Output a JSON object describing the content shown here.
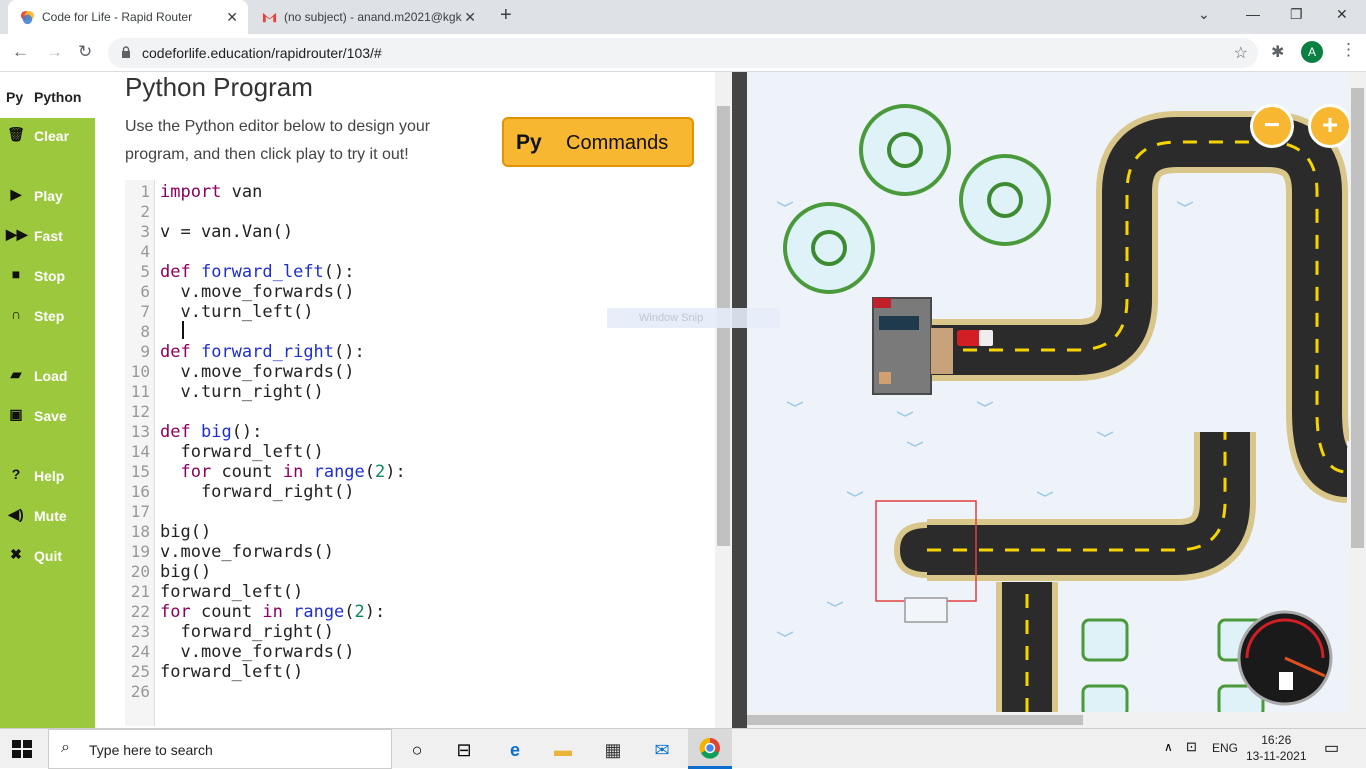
{
  "browser": {
    "tabs": [
      {
        "title": "Code for Life - Rapid Router"
      },
      {
        "title": "(no subject) - anand.m2021@kgk"
      }
    ],
    "url": "codeforlife.education/rapidrouter/103/#",
    "profile_initial": "A"
  },
  "sidebar": {
    "python_tab": {
      "badge": "Py",
      "label": "Python"
    },
    "buttons": [
      {
        "label": "Clear",
        "icon": "trash-icon"
      },
      {
        "label": "Play",
        "icon": "play-icon"
      },
      {
        "label": "Fast",
        "icon": "fast-forward-icon"
      },
      {
        "label": "Stop",
        "icon": "stop-icon"
      },
      {
        "label": "Step",
        "icon": "step-icon"
      },
      {
        "label": "Load",
        "icon": "folder-icon"
      },
      {
        "label": "Save",
        "icon": "save-icon"
      },
      {
        "label": "Help",
        "icon": "help-icon"
      },
      {
        "label": "Mute",
        "icon": "speaker-icon"
      },
      {
        "label": "Quit",
        "icon": "close-icon"
      }
    ]
  },
  "editor": {
    "title": "Python Program",
    "description": "Use the Python editor below to design your program, and then click play to try it out!",
    "commands_button": {
      "badge": "Py",
      "label": "Commands"
    },
    "code_lines": [
      "import van",
      "",
      "v = van.Van()",
      "",
      "def forward_left():",
      "  v.move_forwards()",
      "  v.turn_left()",
      "  ",
      "def forward_right():",
      "  v.move_forwards()",
      "  v.turn_right()",
      "",
      "def big():",
      "  forward_left()",
      "  for count in range(2):",
      "    forward_right()",
      "",
      "big()",
      "v.move_forwards()",
      "big()",
      "forward_left()",
      "for count in range(2):",
      "  forward_right()",
      "  v.move_forwards()",
      "forward_left()",
      ""
    ]
  },
  "map": {
    "zoom_out": "−",
    "zoom_in": "+",
    "overlay": "Window Snip"
  },
  "taskbar": {
    "search_placeholder": "Type here to search",
    "language": "ENG",
    "time": "16:26",
    "date": "13-11-2021"
  }
}
